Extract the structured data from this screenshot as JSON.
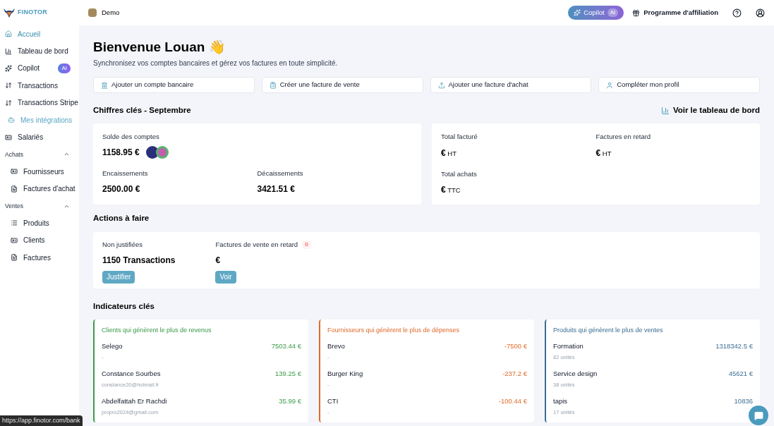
{
  "brand": "FINOTOR",
  "sidebar": {
    "items": [
      {
        "kind": "link",
        "label": "Accueil",
        "selected": true,
        "highlighted": false
      },
      {
        "kind": "link",
        "label": "Tableau de bord",
        "selected": false,
        "highlighted": false
      },
      {
        "kind": "link",
        "label": "Copilot",
        "badge": "AI",
        "selected": false,
        "highlighted": false
      },
      {
        "kind": "link",
        "label": "Transactions",
        "selected": false,
        "highlighted": false
      },
      {
        "kind": "link",
        "label": "Transactions Stripe",
        "selected": false,
        "highlighted": false
      },
      {
        "kind": "link",
        "label": "Mes intégrations",
        "selected": false,
        "highlighted": true
      },
      {
        "kind": "link",
        "label": "Salariés",
        "selected": false,
        "highlighted": false
      },
      {
        "kind": "group",
        "label": "Achats",
        "expanded": true,
        "children": [
          {
            "label": "Fournisseurs",
            "selected": false,
            "highlighted": false
          },
          {
            "label": "Factures d'achat",
            "selected": false,
            "highlighted": false
          }
        ]
      },
      {
        "kind": "group",
        "label": "Ventes",
        "expanded": true,
        "children": [
          {
            "label": "Produits",
            "selected": false,
            "highlighted": false
          },
          {
            "label": "Clients",
            "selected": false,
            "highlighted": false
          },
          {
            "label": "Factures",
            "selected": false,
            "highlighted": false
          }
        ]
      }
    ]
  },
  "topbar": {
    "company": "Demo",
    "copilot": {
      "label": "Copilot",
      "badge": "AI"
    },
    "affiliation": "Programme d'affiliation"
  },
  "welcome": {
    "title": "Bienvenue Louan 👋",
    "subtitle": "Synchronisez vos comptes bancaires et gérez vos factures en toute simplicité."
  },
  "quick_actions": [
    {
      "label": "Ajouter un compte bancaire"
    },
    {
      "label": "Créer une facture de vente"
    },
    {
      "label": "Ajouter une facture d'achat"
    },
    {
      "label": "Compléter mon profil"
    }
  ],
  "key_figures": {
    "title": "Chiffres clés - Septembre",
    "link": "Voir le tableau de bord",
    "balance": {
      "label": "Solde des comptes",
      "value": "1158.95 €"
    },
    "income": {
      "label": "Encaissements",
      "value": "2500.00 €"
    },
    "expenses": {
      "label": "Décaissements",
      "value": "3421.51 €"
    },
    "invoiced": {
      "label": "Total facturé",
      "value": "€",
      "unit": "HT"
    },
    "late": {
      "label": "Factures en retard",
      "value": "€",
      "unit": "HT"
    },
    "purchases": {
      "label": "Total achats",
      "value": "€",
      "unit": "TTC"
    }
  },
  "actions": {
    "title": "Actions à faire",
    "unjustified": {
      "label": "Non justifiées",
      "value": "1150 Transactions",
      "button": "Justifier"
    },
    "late_sales": {
      "label": "Factures de vente en retard",
      "count": "0",
      "value": "€",
      "button": "Voir"
    }
  },
  "indicators": {
    "title": "Indicateurs clés",
    "panels": [
      {
        "title": "Clients qui génèrent le plus de revenus",
        "color": "#3a9a4a",
        "rows": [
          {
            "name": "Selego",
            "sub": "-",
            "amount": "7503.44 €"
          },
          {
            "name": "Constance Sourbes",
            "sub": "constance20@hotmail.fr",
            "amount": "139.25 €"
          },
          {
            "name": "Abdelfattah Er Rachdi",
            "sub": "propro2024@gmail.com",
            "amount": "35.99 €"
          }
        ]
      },
      {
        "title": "Fournisseurs qui génèrent le plus de dépenses",
        "color": "#e06a2a",
        "rows": [
          {
            "name": "Brevo",
            "sub": "-",
            "amount": "-7500 €"
          },
          {
            "name": "Burger King",
            "sub": "-",
            "amount": "-237.2 €"
          },
          {
            "name": "CTI",
            "sub": "-",
            "amount": "-100.44 €"
          }
        ]
      },
      {
        "title": "Produits qui génèrent le plus de ventes",
        "color": "#3b6e93",
        "rows": [
          {
            "name": "Formation",
            "sub": "82 unités",
            "amount": "1318342.5 €"
          },
          {
            "name": "Service design",
            "sub": "38 unités",
            "amount": "45621 €"
          },
          {
            "name": "tapis",
            "sub": "17 unités",
            "amount": "10836"
          }
        ]
      }
    ]
  },
  "status_url": "https://app.finotor.com/bank"
}
